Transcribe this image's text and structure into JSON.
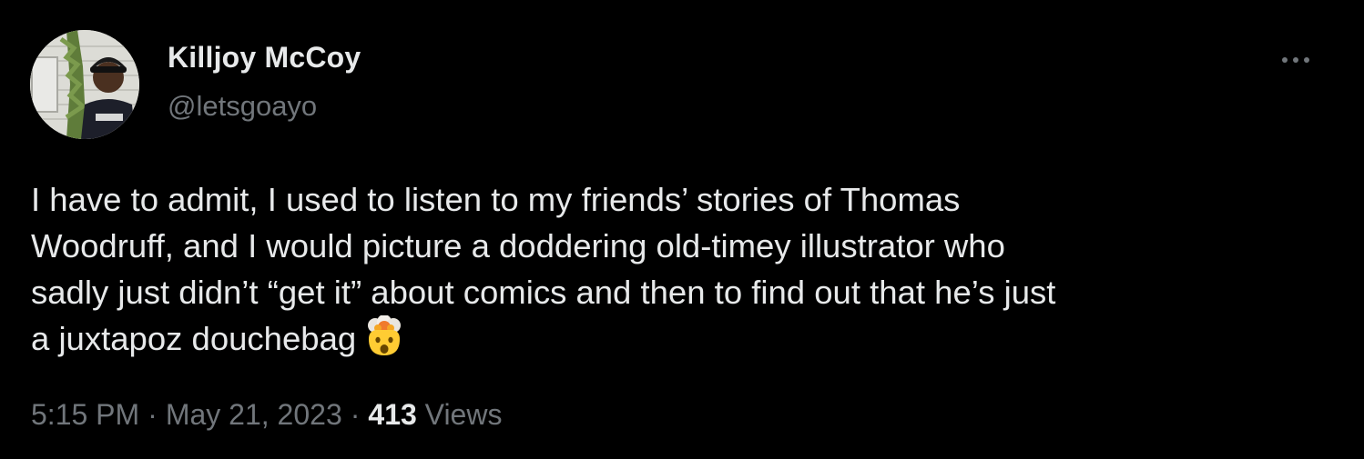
{
  "author": {
    "display_name": "Killjoy McCoy",
    "handle": "@letsgoayo",
    "avatar_icon": "profile-photo-avatar"
  },
  "more_icon": "ellipsis-more-icon",
  "tweet": {
    "lines": [
      "I have to admit, I used to listen to my friends’ stories of Thomas",
      "Woodruff, and I would picture a doddering old-timey illustrator who",
      "sadly just didn’t “get it” about comics and then to find out that he’s just",
      "a juxtapoz douchebag"
    ],
    "emoji": "exploding-head-emoji"
  },
  "meta": {
    "time": "5:15 PM",
    "separator": "·",
    "date": "May 21, 2023",
    "views_count": "413",
    "views_label": "Views"
  },
  "colors": {
    "background": "#000000",
    "primary_text": "#e7e9ea",
    "secondary_text": "#71767b"
  }
}
